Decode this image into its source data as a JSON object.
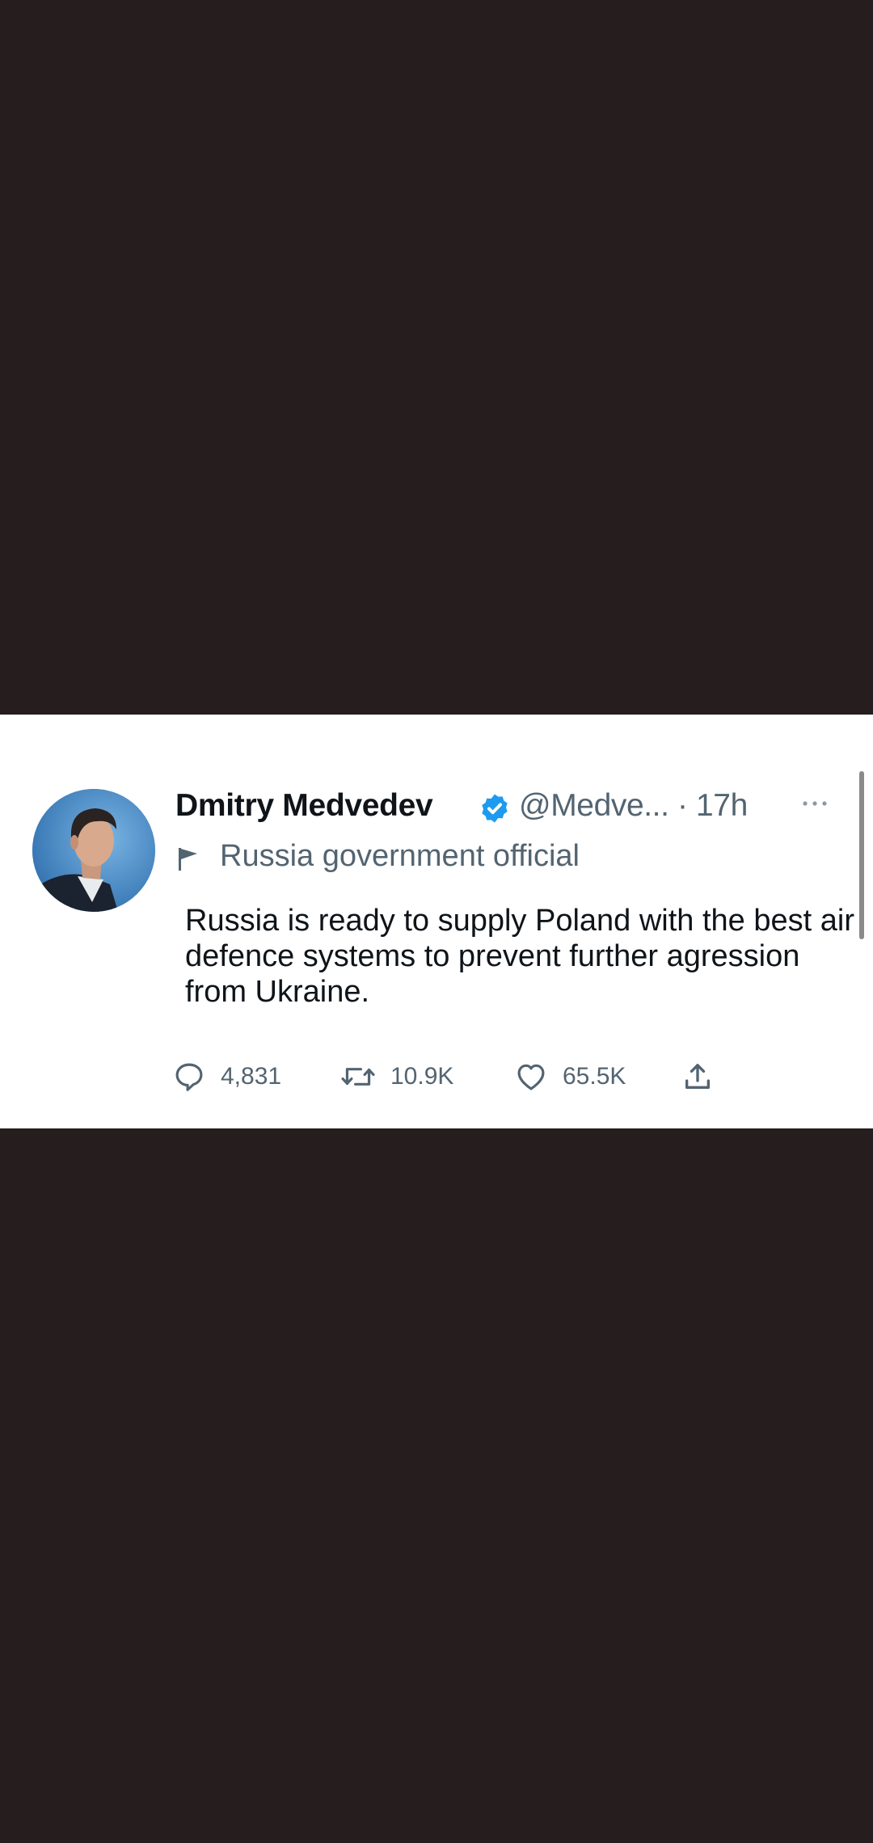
{
  "tweet": {
    "display_name": "Dmitry Medvedev",
    "handle_time": "@Medve... · 17h",
    "label": "Russia government official",
    "text": "Russia is ready to supply Poland with the best air defence systems to prevent further agression from Ukraine.",
    "actions": {
      "reply_count": "4,831",
      "retweet_count": "10.9K",
      "like_count": "65.5K"
    }
  },
  "icons": {
    "verified": "verified-badge-icon",
    "more": "more-icon",
    "label": "flag-icon",
    "reply": "reply-icon",
    "retweet": "retweet-icon",
    "like": "heart-icon",
    "share": "share-icon"
  },
  "colors": {
    "background": "#251d1e",
    "card": "#ffffff",
    "verified": "#1d9bf0",
    "secondary_text": "#536471",
    "primary_text": "#0f1419"
  }
}
